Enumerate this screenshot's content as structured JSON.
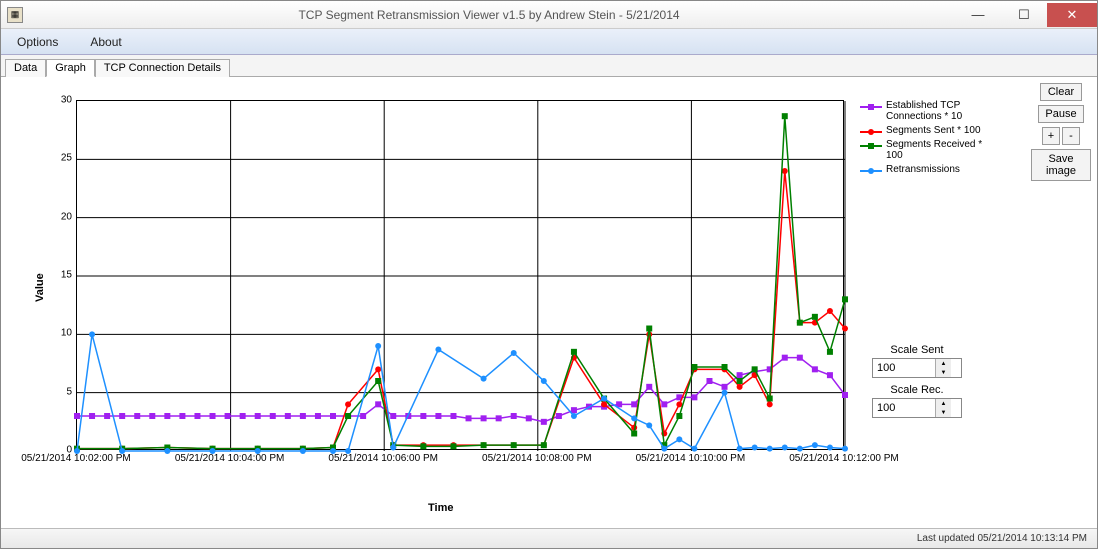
{
  "window": {
    "title": "TCP Segment Retransmission Viewer v1.5 by Andrew Stein - 5/21/2014"
  },
  "menu": {
    "options": "Options",
    "about": "About"
  },
  "tabs": {
    "data": "Data",
    "graph": "Graph",
    "details": "TCP Connection Details"
  },
  "buttons": {
    "clear": "Clear",
    "pause": "Pause",
    "plus": "+",
    "minus": "-",
    "save": "Save image"
  },
  "scale": {
    "sent_label": "Scale Sent",
    "sent_value": "100",
    "rec_label": "Scale Rec.",
    "rec_value": "100"
  },
  "axes": {
    "ylabel": "Value",
    "xlabel": "Time"
  },
  "legend": {
    "s1": "Established TCP Connections * 10",
    "s2": "Segments Sent * 100",
    "s3": "Segments Received * 100",
    "s4": "Retransmissions"
  },
  "status": {
    "text": "Last updated 05/21/2014 10:13:14 PM"
  },
  "chart_data": {
    "type": "line",
    "xlabel": "Time",
    "ylabel": "Value",
    "ylim": [
      0,
      30
    ],
    "x_ticks": [
      "05/21/2014 10:02:00 PM",
      "05/21/2014 10:04:00 PM",
      "05/21/2014 10:06:00 PM",
      "05/21/2014 10:08:00 PM",
      "05/21/2014 10:10:00 PM",
      "05/21/2014 10:12:00 PM"
    ],
    "y_ticks": [
      0,
      5,
      10,
      15,
      20,
      25,
      30
    ],
    "series": [
      {
        "name": "Established TCP Connections * 10",
        "color": "#a020f0",
        "marker": "square",
        "x_index": [
          0,
          1,
          2,
          3,
          4,
          5,
          6,
          7,
          8,
          9,
          10,
          11,
          12,
          13,
          14,
          15,
          16,
          17,
          18,
          19,
          20,
          21,
          22,
          23,
          24,
          25,
          26,
          27,
          28,
          29,
          30,
          31,
          32,
          33,
          34,
          35,
          36,
          37,
          38,
          39,
          40,
          41,
          42,
          43,
          44,
          45,
          46,
          47,
          48,
          49,
          50,
          51
        ],
        "values": [
          3,
          3,
          3,
          3,
          3,
          3,
          3,
          3,
          3,
          3,
          3,
          3,
          3,
          3,
          3,
          3,
          3,
          3,
          3,
          3,
          4,
          3,
          3,
          3,
          3,
          3,
          2.8,
          2.8,
          2.8,
          3,
          2.8,
          2.5,
          3,
          3.5,
          3.8,
          3.8,
          4,
          4,
          5.5,
          4,
          4.6,
          4.6,
          6,
          5.5,
          6.5,
          6.8,
          7,
          8,
          8,
          7,
          6.5,
          4.8
        ]
      },
      {
        "name": "Segments Sent * 100",
        "color": "#ff0000",
        "marker": "dot",
        "x_index": [
          0,
          3,
          6,
          9,
          12,
          15,
          17,
          18,
          20,
          21,
          23,
          25,
          27,
          29,
          31,
          33,
          35,
          37,
          38,
          39,
          40,
          41,
          43,
          44,
          45,
          46,
          47,
          48,
          49,
          50,
          51
        ],
        "values": [
          0.2,
          0.2,
          0.3,
          0.2,
          0.2,
          0.2,
          0.3,
          4,
          7,
          0.5,
          0.5,
          0.5,
          0.5,
          0.5,
          0.5,
          8,
          4,
          2,
          10,
          1.5,
          4,
          7,
          7,
          5.5,
          6.5,
          4,
          24,
          11,
          11,
          12,
          10.5
        ]
      },
      {
        "name": "Segments Received * 100",
        "color": "#008000",
        "marker": "square",
        "x_index": [
          0,
          3,
          6,
          9,
          12,
          15,
          17,
          18,
          20,
          21,
          23,
          25,
          27,
          29,
          31,
          33,
          35,
          37,
          38,
          39,
          40,
          41,
          43,
          44,
          45,
          46,
          47,
          48,
          49,
          50,
          51
        ],
        "values": [
          0.2,
          0.2,
          0.3,
          0.2,
          0.2,
          0.2,
          0.3,
          3,
          6,
          0.5,
          0.4,
          0.4,
          0.5,
          0.5,
          0.5,
          8.5,
          4.5,
          1.5,
          10.5,
          0.5,
          3,
          7.2,
          7.2,
          6,
          7,
          4.5,
          28.7,
          11,
          11.5,
          8.5,
          13
        ]
      },
      {
        "name": "Retransmissions",
        "color": "#1e90ff",
        "marker": "dot",
        "x_index": [
          0,
          1,
          3,
          6,
          9,
          12,
          15,
          17,
          18,
          20,
          21,
          24,
          27,
          29,
          31,
          33,
          35,
          37,
          38,
          39,
          40,
          41,
          43,
          44,
          45,
          46,
          47,
          48,
          49,
          50,
          51
        ],
        "values": [
          0,
          10,
          0,
          0,
          0,
          0,
          0,
          0,
          0,
          9,
          0.3,
          8.7,
          6.2,
          8.4,
          6,
          3,
          4.5,
          2.8,
          2.2,
          0.2,
          1,
          0.2,
          5,
          0.2,
          0.3,
          0.2,
          0.3,
          0.2,
          0.5,
          0.3,
          0.2
        ]
      }
    ]
  }
}
